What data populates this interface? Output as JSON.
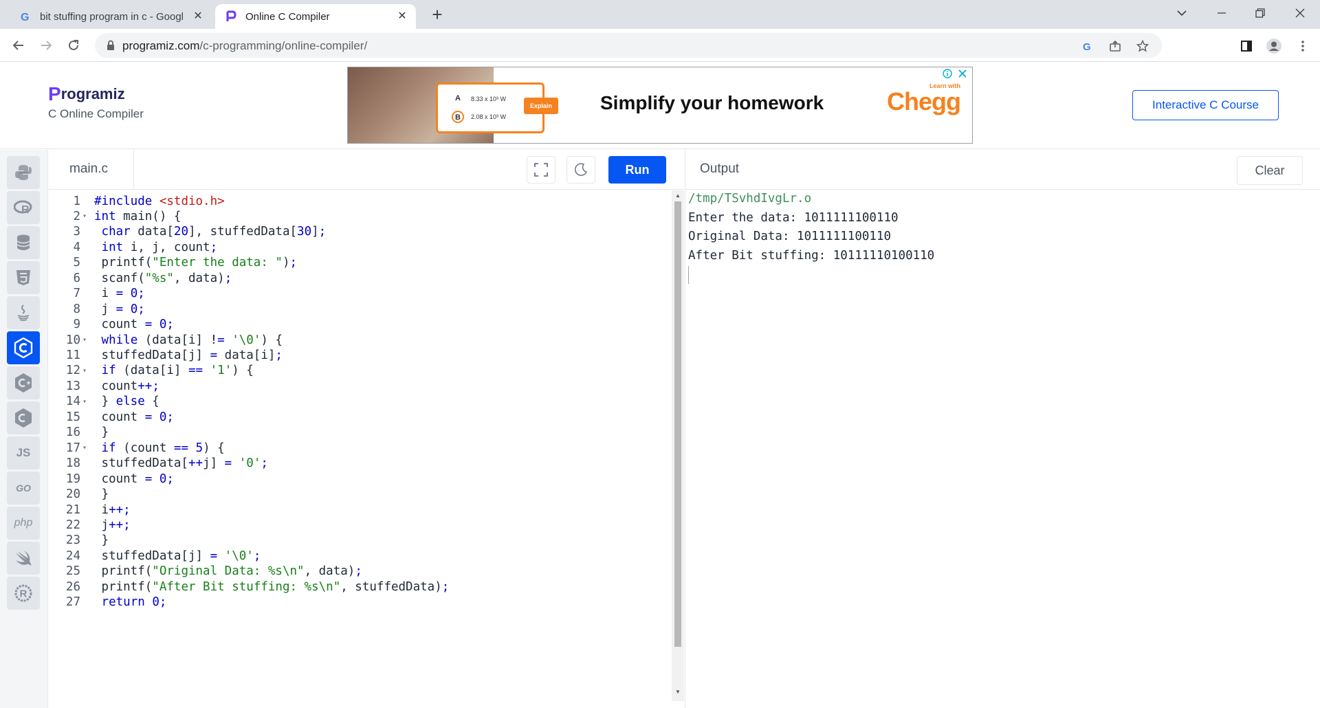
{
  "browser": {
    "tabs": [
      {
        "title": "bit stuffing program in c - Googl",
        "icon": "google-g-icon"
      },
      {
        "title": "Online C Compiler",
        "icon": "programiz-icon"
      }
    ],
    "new_tab": "+",
    "url_host": "programiz.com",
    "url_path": "/c-programming/online-compiler/"
  },
  "site": {
    "brand_p": "P",
    "brand_rest": "rogramiz",
    "brand_subtitle": "C Online Compiler",
    "ad_headline": "Simplify your homework",
    "ad_brand_small": "Learn with",
    "ad_brand": "Chegg",
    "ad_explain": "Explain",
    "ad_option_a_letter": "A",
    "ad_option_a": "8.33 x 10³ W",
    "ad_option_b_letter": "B",
    "ad_option_b": "2.08 x 10³ W",
    "course_button": "Interactive C Course"
  },
  "sidebar": {
    "languages": [
      "python",
      "r",
      "sql",
      "html",
      "java",
      "c",
      "c++",
      "c#",
      "js",
      "go",
      "php",
      "swift",
      "rust"
    ],
    "active": "c",
    "js_label": "JS",
    "go_label": "GO",
    "php_label": "php"
  },
  "editor": {
    "filename": "main.c",
    "run_label": "Run",
    "lines": [
      {
        "n": "1",
        "fold": "",
        "code": "#include <stdio.h>"
      },
      {
        "n": "2",
        "fold": "▾",
        "code": "int main() {"
      },
      {
        "n": "3",
        "fold": "",
        "code": " char data[20], stuffedData[30];"
      },
      {
        "n": "4",
        "fold": "",
        "code": " int i, j, count;"
      },
      {
        "n": "5",
        "fold": "",
        "code": " printf(\"Enter the data: \");"
      },
      {
        "n": "6",
        "fold": "",
        "code": " scanf(\"%s\", data);"
      },
      {
        "n": "7",
        "fold": "",
        "code": " i = 0;"
      },
      {
        "n": "8",
        "fold": "",
        "code": " j = 0;"
      },
      {
        "n": "9",
        "fold": "",
        "code": " count = 0;"
      },
      {
        "n": "10",
        "fold": "▾",
        "code": " while (data[i] != '\\0') {"
      },
      {
        "n": "11",
        "fold": "",
        "code": " stuffedData[j] = data[i];"
      },
      {
        "n": "12",
        "fold": "▾",
        "code": " if (data[i] == '1') {"
      },
      {
        "n": "13",
        "fold": "",
        "code": " count++;"
      },
      {
        "n": "14",
        "fold": "▾",
        "code": " } else {"
      },
      {
        "n": "15",
        "fold": "",
        "code": " count = 0;"
      },
      {
        "n": "16",
        "fold": "",
        "code": " }"
      },
      {
        "n": "17",
        "fold": "▾",
        "code": " if (count == 5) {"
      },
      {
        "n": "18",
        "fold": "",
        "code": " stuffedData[++j] = '0';"
      },
      {
        "n": "19",
        "fold": "",
        "code": " count = 0;"
      },
      {
        "n": "20",
        "fold": "",
        "code": " }"
      },
      {
        "n": "21",
        "fold": "",
        "code": " i++;"
      },
      {
        "n": "22",
        "fold": "",
        "code": " j++;"
      },
      {
        "n": "23",
        "fold": "",
        "code": " }"
      },
      {
        "n": "24",
        "fold": "",
        "code": " stuffedData[j] = '\\0';"
      },
      {
        "n": "25",
        "fold": "",
        "code": " printf(\"Original Data: %s\\n\", data);"
      },
      {
        "n": "26",
        "fold": "",
        "code": " printf(\"After Bit stuffing: %s\\n\", stuffedData);"
      },
      {
        "n": "27",
        "fold": "",
        "code": " return 0;"
      }
    ]
  },
  "output": {
    "title": "Output",
    "clear_label": "Clear",
    "lines": [
      "/tmp/TSvhdIvgLr.o",
      "Enter the data: 1011111100110",
      "Original Data: 1011111100110",
      "After Bit stuffing: 10111110100110"
    ]
  },
  "colors": {
    "accent": "#0556f3",
    "chegg": "#f5821f",
    "keyword": "#0000cc",
    "string": "#1a7f1a",
    "include": "#c41a16"
  }
}
